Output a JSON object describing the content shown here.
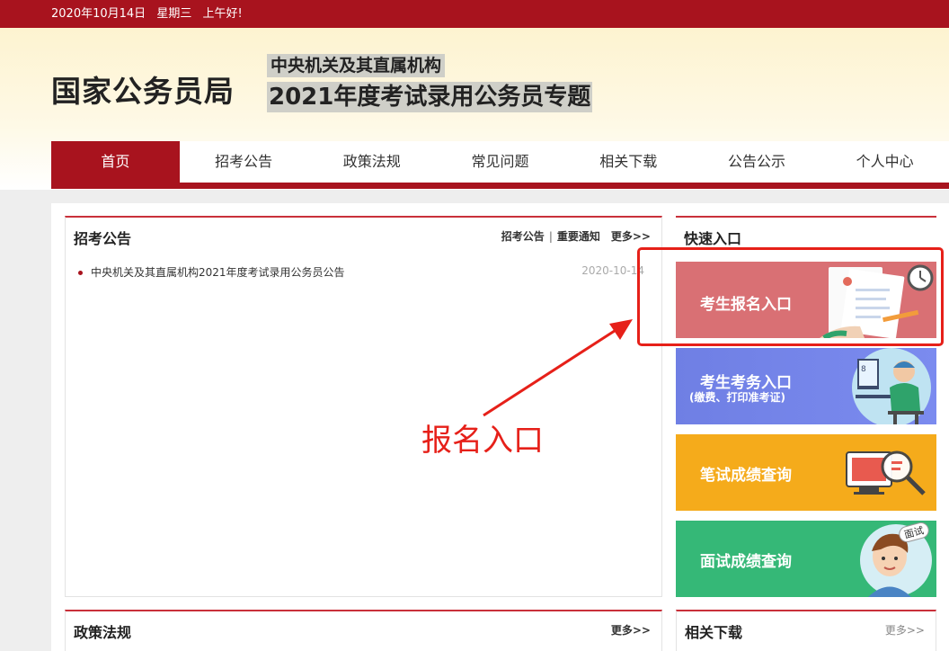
{
  "topbar": {
    "date": "2020年10月14日",
    "weekday": "星期三",
    "greeting": "上午好!"
  },
  "header": {
    "logo": "国家公务员局",
    "subtitle1": "中央机关及其直属机构",
    "subtitle2": "2021年度考试录用公务员专题"
  },
  "nav": [
    {
      "label": "首页",
      "active": true
    },
    {
      "label": "招考公告"
    },
    {
      "label": "政策法规"
    },
    {
      "label": "常见问题"
    },
    {
      "label": "相关下载"
    },
    {
      "label": "公告公示"
    },
    {
      "label": "个人中心"
    }
  ],
  "notice_panel": {
    "title": "招考公告",
    "link1": "招考公告",
    "sep": "|",
    "link2": "重要通知",
    "more": "更多>>",
    "items": [
      {
        "title": "中央机关及其直属机构2021年度考试录用公务员公告",
        "date": "2020-10-14"
      }
    ]
  },
  "quick_panel": {
    "title": "快速入口",
    "tiles": [
      {
        "label": "考生报名入口",
        "color": "#d97074"
      },
      {
        "label": "考生考务入口",
        "sub": "(缴费、打印准考证)",
        "color": "#6f7fe4"
      },
      {
        "label": "笔试成绩查询",
        "color": "#f5ab1b"
      },
      {
        "label": "面试成绩查询",
        "color": "#35b877",
        "badge": "面试"
      }
    ]
  },
  "policy_panel": {
    "title": "政策法规",
    "more": "更多>>"
  },
  "download_panel": {
    "title": "相关下载",
    "more": "更多>>"
  },
  "annotation": {
    "text": "报名入口",
    "color": "#e62019"
  }
}
